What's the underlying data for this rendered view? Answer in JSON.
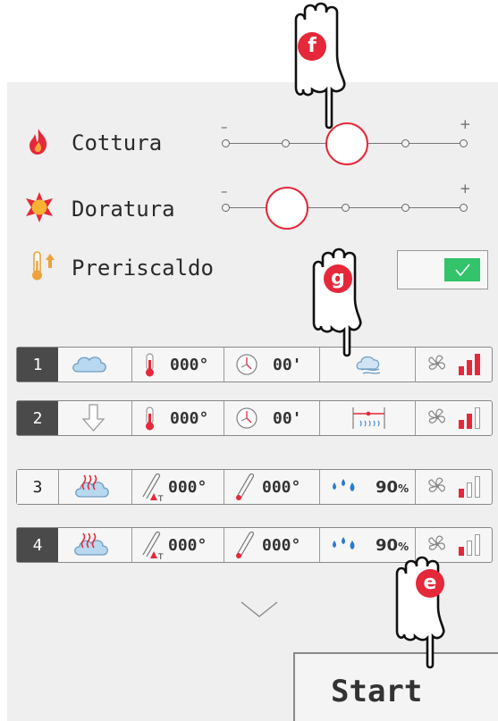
{
  "settings": {
    "cottura": {
      "label": "Cottura",
      "level_index": 2,
      "steps": 5
    },
    "doratura": {
      "label": "Doratura",
      "level_index": 1,
      "steps": 5
    },
    "preriscaldo": {
      "label": "Preriscaldo",
      "enabled": true
    }
  },
  "slider": {
    "min_symbol": "–",
    "max_symbol": "+"
  },
  "steps": [
    {
      "number": "1",
      "mode_icon": "steam-cloud-icon",
      "temp": "000°",
      "time": "00'",
      "extra_icon": "air-flow-icon",
      "fan_level": 3
    },
    {
      "number": "2",
      "mode_icon": "down-arrow-icon",
      "temp": "000°",
      "time": "00'",
      "extra_icon": "heating-element-icon",
      "fan_level": 2
    },
    {
      "number": "3",
      "mode_icon": "combi-steam-icon",
      "probe_temp": "000°",
      "core_temp": "000°",
      "humidity": "90",
      "humidity_unit": "%",
      "fan_level": 1
    },
    {
      "number": "4",
      "mode_icon": "combi-steam-icon",
      "probe_temp": "000°",
      "core_temp": "000°",
      "humidity": "90",
      "humidity_unit": "%",
      "fan_level": 1
    }
  ],
  "start_label": "Start",
  "callouts": [
    "f",
    "g",
    "e"
  ],
  "colors": {
    "accent": "#e5283a",
    "toggle_on": "#32c36b",
    "step_dark": "#4a4a4a"
  }
}
